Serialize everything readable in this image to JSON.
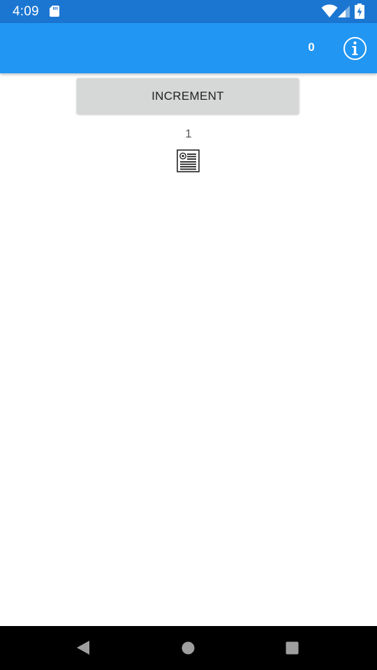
{
  "status_bar": {
    "time": "4:09",
    "icons": [
      "sd-card-icon",
      "wifi-icon",
      "cell-signal-icon",
      "battery-charging-icon"
    ]
  },
  "app_bar": {
    "count": "0",
    "info_icon": "info-icon"
  },
  "main": {
    "increment_label": "INCREMENT",
    "counter_value": "1",
    "content_icon": "newspaper-icon"
  },
  "nav_bar": {
    "icons": [
      "back-icon",
      "home-icon",
      "recents-icon"
    ]
  },
  "colors": {
    "status_bar": "#1b76d2",
    "app_bar": "#2196f3",
    "button_bg": "#d6d7d7",
    "nav_bar": "#000000"
  }
}
